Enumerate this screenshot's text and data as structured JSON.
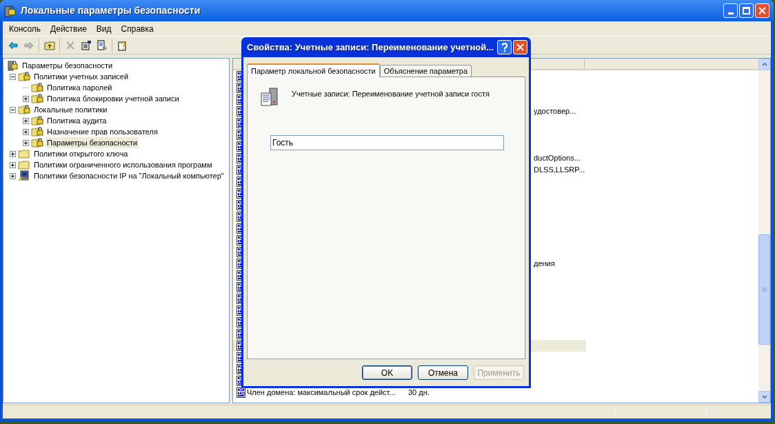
{
  "window": {
    "title": "Локальные параметры безопасности"
  },
  "menu": [
    "Консоль",
    "Действие",
    "Вид",
    "Справка"
  ],
  "toolbar": [
    {
      "kind": "back",
      "disabled": false
    },
    {
      "kind": "forward",
      "disabled": true
    },
    {
      "kind": "up",
      "disabled": false
    },
    {
      "kind": "delete",
      "disabled": true
    },
    {
      "kind": "properties",
      "disabled": false
    },
    {
      "kind": "export",
      "disabled": false
    },
    {
      "kind": "help",
      "disabled": false
    }
  ],
  "tree": [
    {
      "label": "Параметры безопасности",
      "kind": "root",
      "selected": false,
      "children": [
        {
          "label": "Политики учетных записей",
          "kind": "locked",
          "expanded": true,
          "selected": false,
          "children": [
            {
              "label": "Политика паролей",
              "kind": "lockedleaf",
              "selected": false
            },
            {
              "label": "Политика блокировки учетной записи",
              "kind": "locked",
              "expanded": false,
              "selected": false
            }
          ]
        },
        {
          "label": "Локальные политики",
          "kind": "locked",
          "expanded": true,
          "selected": false,
          "children": [
            {
              "label": "Политика аудита",
              "kind": "locked",
              "expanded": false,
              "selected": false
            },
            {
              "label": "Назначение прав пользователя",
              "kind": "locked",
              "expanded": false,
              "selected": false
            },
            {
              "label": "Параметры безопасности",
              "kind": "locked",
              "expanded": false,
              "selected": true
            }
          ]
        },
        {
          "label": "Политики открытого ключа",
          "kind": "folder",
          "expanded": false,
          "selected": false
        },
        {
          "label": "Политики ограниченного использования программ",
          "kind": "folder",
          "expanded": false,
          "selected": false
        },
        {
          "label": "Политики безопасности IP на \"Локальный компьютер\"",
          "kind": "network",
          "expanded": false,
          "selected": false
        }
      ]
    }
  ],
  "list": {
    "rows": [
      {
        "kind": "hidden",
        "selected": false
      },
      {
        "kind": "hidden",
        "selected": false
      },
      {
        "kind": "hidden",
        "selected": false
      },
      {
        "kind": "partial",
        "col2": "удостовер...",
        "selected": false
      },
      {
        "kind": "hidden",
        "selected": false
      },
      {
        "kind": "hidden",
        "selected": false
      },
      {
        "kind": "hidden",
        "selected": false
      },
      {
        "kind": "partial",
        "col2": "ductOptions...",
        "selected": false
      },
      {
        "kind": "partial",
        "col2": "DLSS,LLSRP...",
        "selected": false
      },
      {
        "kind": "hidden",
        "selected": false
      },
      {
        "kind": "hidden",
        "selected": false
      },
      {
        "kind": "hidden",
        "selected": false
      },
      {
        "kind": "hidden",
        "selected": false
      },
      {
        "kind": "hidden",
        "selected": false
      },
      {
        "kind": "hidden",
        "selected": false
      },
      {
        "kind": "hidden",
        "selected": false
      },
      {
        "kind": "partial",
        "col2": "дения",
        "selected": false
      },
      {
        "kind": "hidden",
        "selected": false
      },
      {
        "kind": "hidden",
        "selected": false
      },
      {
        "kind": "hidden",
        "selected": false
      },
      {
        "kind": "hidden",
        "selected": false
      },
      {
        "kind": "hidden",
        "selected": false
      },
      {
        "kind": "hidden",
        "selected": false
      },
      {
        "kind": "hidden",
        "selected": true
      },
      {
        "kind": "hidden",
        "selected": false
      },
      {
        "kind": "hidden",
        "selected": false
      },
      {
        "kind": "hidden",
        "selected": false
      },
      {
        "kind": "full",
        "col1": "Член домена: максимальный срок дейст...",
        "col2": "30 дн.",
        "selected": false
      }
    ]
  },
  "dialog": {
    "title": "Свойства: Учетные записи: Переименование учетной...",
    "tabs": [
      {
        "label": "Параметр локальной безопасности",
        "selected": true
      },
      {
        "label": "Объяснение параметра",
        "selected": false
      }
    ],
    "policy": "Учетные записи: Переименование учетной записи гостя",
    "value": "Гость",
    "buttons": [
      {
        "label": "OK",
        "kind": "default",
        "disabled": false
      },
      {
        "label": "Отмена",
        "kind": "normal",
        "disabled": false
      },
      {
        "label": "Применить",
        "kind": "normal",
        "disabled": true
      }
    ]
  }
}
